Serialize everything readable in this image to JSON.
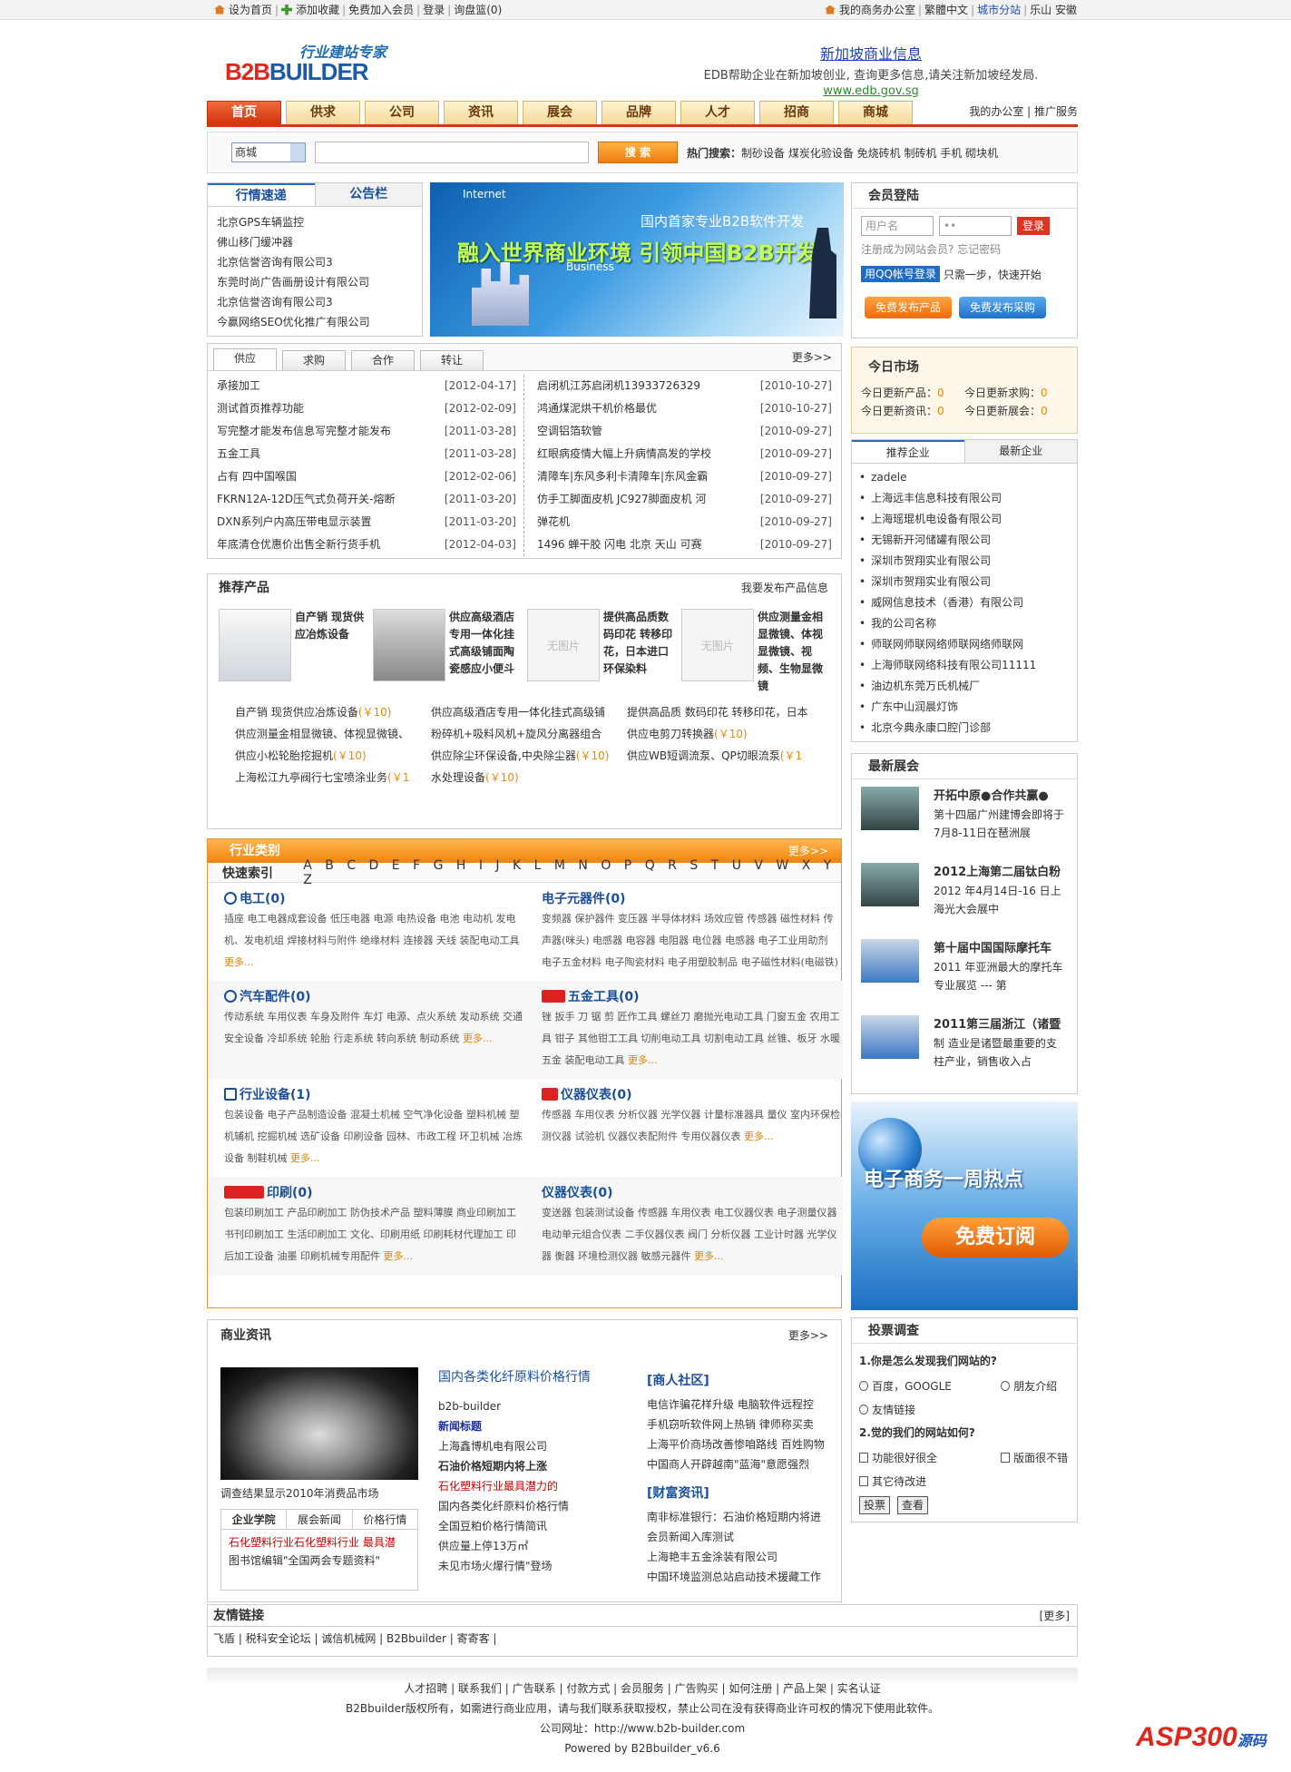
{
  "topbar": {
    "left": [
      "设为首页",
      "添加收藏",
      "免费加入会员",
      "登录",
      "询盘篮(0)"
    ],
    "right_office": "我的商务办公室",
    "right_lang": "繁體中文",
    "right_city": "城市分站",
    "right_region": "乐山 安徽"
  },
  "logo": {
    "slogan": "行业建站专家",
    "name_a": "B2B",
    "name_b": "BUILDER"
  },
  "ad": {
    "line1": "新加坡商业信息",
    "line2": "EDB帮助企业在新加坡创业, 查询更多信息,请关注新加坡经发局.",
    "line3": "www.edb.gov.sg"
  },
  "nav": {
    "tabs": [
      "首页",
      "供求",
      "公司",
      "资讯",
      "展会",
      "品牌",
      "人才",
      "招商",
      "商城"
    ],
    "right": "我的办公室 | 推广服务"
  },
  "search": {
    "select": "商城",
    "button": "搜 索",
    "hot_label": "热门搜索：",
    "hot": "制砂设备 煤炭化验设备 免烧砖机 制砖机 手机 砌块机"
  },
  "market": {
    "tabs": [
      "行情速递",
      "公告栏"
    ],
    "items": [
      "北京GPS车辆监控",
      "佛山移门缓冲器",
      "北京信誉咨询有限公司3",
      "东莞时尚广告画册设计有限公司",
      "北京信誉咨询有限公司3",
      "今赢网络SEO优化推广有限公司"
    ]
  },
  "banner": {
    "net": "Internet",
    "line1": "国内首家专业B2B软件开发",
    "line2": "融入世界商业环境  引领中国B2B开发",
    "business": "Business"
  },
  "supply": {
    "tabs": [
      "供应",
      "求购",
      "合作",
      "转让"
    ],
    "more": "更多>>",
    "left": [
      {
        "t": "承接加工",
        "d": "[2012-04-17]"
      },
      {
        "t": "测试首页推荐功能",
        "d": "[2012-02-09]"
      },
      {
        "t": "写完整才能发布信息写完整才能发布",
        "d": "[2011-03-28]"
      },
      {
        "t": "五金工具",
        "d": "[2011-03-28]"
      },
      {
        "t": "占有 四中国喉国",
        "d": "[2012-02-06]"
      },
      {
        "t": "FKRN12A-12D压气式负荷开关-熔断",
        "d": "[2011-03-20]"
      },
      {
        "t": "DXN系列户内高压带电显示装置",
        "d": "[2011-03-20]"
      },
      {
        "t": "年底清仓优惠价出售全新行货手机",
        "d": "[2012-04-03]"
      }
    ],
    "right": [
      {
        "t": "启闭机江苏启闭机13933726329",
        "d": "[2010-10-27]"
      },
      {
        "t": "鸿通煤泥烘干机价格最优",
        "d": "[2010-10-27]"
      },
      {
        "t": "空调铝箔软管",
        "d": "[2010-09-27]"
      },
      {
        "t": "红眼病疫情大幅上升病情高发的学校",
        "d": "[2010-09-27]"
      },
      {
        "t": "清障车|东风多利卡清障车|东风金霸",
        "d": "[2010-09-27]"
      },
      {
        "t": "仿手工脚面皮机 JC927脚面皮机 河",
        "d": "[2010-09-27]"
      },
      {
        "t": "弹花机",
        "d": "[2010-09-27]"
      },
      {
        "t": "1496 蝉干胶 闪电 北京 天山 可赛",
        "d": "[2010-09-27]"
      }
    ]
  },
  "products": {
    "title": "推荐产品",
    "more": "我要发布产品信息",
    "noimg": "无图片",
    "items": [
      "自产销 现货供应冶炼设备",
      "供应高级酒店专用一体化挂式高级铺面陶瓷感应小便斗",
      "提供高品质数码印花 转移印花，日本进口环保染料",
      "供应测量金相显微镜、体视显微镜、视频、生物显微镜"
    ],
    "list": [
      {
        "t": "自产销 现货供应冶炼设备",
        "p": "(￥10)"
      },
      {
        "t": "供应高级酒店专用一体化挂式高级铺",
        "p": ""
      },
      {
        "t": "提供高品质 数码印花 转移印花，日本",
        "p": ""
      },
      {
        "t": "供应测量金相显微镜、体视显微镜、",
        "p": ""
      },
      {
        "t": "粉碎机+吸料风机+旋风分离器组合",
        "p": ""
      },
      {
        "t": "供应电剪刀转换器",
        "p": "(￥10)"
      },
      {
        "t": "供应小松轮胎挖掘机",
        "p": "(￥10)"
      },
      {
        "t": "供应除尘环保设备,中央除尘器",
        "p": "(￥10)"
      },
      {
        "t": "供应WB短调流泵、QP切眼流泵",
        "p": "(￥1"
      },
      {
        "t": "上海松江九亭阀行七宝喷涂业务",
        "p": "(￥1"
      },
      {
        "t": "水处理设备",
        "p": "(￥10)"
      },
      {
        "t": "",
        "p": ""
      }
    ]
  },
  "category": {
    "title": "行业类别",
    "more": "更多>>",
    "index_label": "快速索引",
    "letters": "A B C D E F G H I J K L M N O P Q R S T U V W X Y Z",
    "more_link": "更多...",
    "cells": [
      {
        "t": "电工(0)",
        "b": "插座 电工电器成套设备 低压电器 电源 电热设备 电池 电动机 发电机、发电机组 焊接材料与附件 绝缘材料 连接器 天线 装配电动工具"
      },
      {
        "t": "电子元器件(0)",
        "b": "变频器 保护器件 变压器 半导体材料 场效应管 传感器 磁性材料 传声器(咪头) 电感器 电容器 电阻器 电位器 电感器 电子工业用助剂 电子五金材料 电子陶瓷材料 电子用塑胶制品 电子磁性材料(电磁铁) 敏感元器件"
      },
      {
        "t": "汽车配件(0)",
        "b": "传动系统 车用仪表 车身及附件 车灯 电源、点火系统 发动系统 交通安全设备 冷却系统 轮胎 行走系统 转向系统 制动系统"
      },
      {
        "t": "五金工具(0)",
        "b": "锉 扳手 刀 锯 剪 匠作工具 螺丝刀 磨抛光电动工具 门窗五金 农用工具 钳子 其他钳工工具 切削电动工具 切割电动工具 丝锥、板牙 水暖五金 装配电动工具"
      },
      {
        "t": "行业设备(1)",
        "b": "包装设备 电子产品制造设备 混凝土机械 空气净化设备 塑料机械 塑机辅机 挖掘机械 选矿设备 印刷设备 园林、市政工程 环卫机械 冶炼设备 制鞋机械"
      },
      {
        "t": "仪器仪表(0)",
        "b": "传感器 车用仪表 分析仪器 光学仪器 计量标准器具 量仪 室内环保检测仪器 试验机 仪器仪表配附件 专用仪器仪表"
      },
      {
        "t": "印刷(0)",
        "b": "包装印刷加工 产品印刷加工 防伪技术产品 塑料薄膜 商业印刷加工 书刊印刷加工 生活印刷加工 文化、印刷用纸 印刷耗材代理加工 印后加工设备 油墨 印刷机械专用配件"
      },
      {
        "t": "仪器仪表(0)",
        "b": "变送器 包装测试设备 传感器 车用仪表 电工仪器仪表 电子测量仪器 电动单元组合仪表 二手仪器仪表 阀门 分析仪器 工业计时器 光学仪器 衡器 环境检测仪器 敏感元器件"
      }
    ]
  },
  "biz": {
    "title": "商业资讯",
    "more": "更多>>",
    "caption": "调查结果显示2010年消费品市场",
    "tabs": [
      "企业学院",
      "展会新闻",
      "价格行情"
    ],
    "tab_items": [
      "石化塑料行业石化塑料行业 最具潜",
      "图书馆编辑\"全国两会专题资料\""
    ],
    "mid_head": "国内各类化纤原料价格行情",
    "mid": [
      "b2b-builder",
      "新闻标题",
      "上海鑫博机电有限公司",
      "石油价格短期内将上涨",
      "石化塑料行业最具潜力的",
      "国内各类化纤原料价格行情",
      "全国豆粕价格行情简讯",
      "供应量上停13万㎡",
      "未见市场火爆行情\"登场"
    ],
    "r_head1": "[商人社区]",
    "r1": [
      "电信诈骗花样升级 电脑软件远程控",
      "手机窃听软件网上热销 律师称买卖",
      "上海平价商场改善惨咱路线 百姓购物",
      "中国商人开辟越南\"蓝海\"意愿强烈"
    ],
    "r_head2": "[财富资讯]",
    "r2": [
      "南非标准银行：石油价格短期内将进",
      "会员新闻入库测试",
      "上海艳丰五金涂装有限公司",
      "中国环境监测总站启动技术援藏工作"
    ]
  },
  "links": {
    "title": "友情链接",
    "more": "[更多]",
    "items": "飞盾 | 税科安全论坛 | 诚信机械网 | B2Bbuilder | 寄寄客 |"
  },
  "footer": {
    "line1": "人才招聘 | 联系我们 | 广告联系 | 付款方式 | 会员服务 | 广告购买 | 如何注册 | 产品上架 | 实名认证",
    "line2": "B2Bbuilder版权所有，如需进行商业应用，请与我们联系获取授权，禁止公司在没有获得商业许可权的情况下使用此软件。",
    "line3": "公司网址：http://www.b2b-builder.com",
    "line4": "Powered by B2Bbuilder_v6.6"
  },
  "login": {
    "title": "会员登陆",
    "user_ph": "用户名",
    "pass_ph": "••",
    "btn": "登录",
    "links": "注册成为网站会员? 忘记密码",
    "qq_btn": "用QQ帐号登录",
    "qq_text": "只需一步，快速开始",
    "pub1": "免费发布产品",
    "pub2": "免费发布采购"
  },
  "today": {
    "title": "今日市场",
    "rows": [
      [
        "今日更新产品：",
        "0",
        "今日更新求购：",
        "0"
      ],
      [
        "今日更新资讯：",
        "0",
        "今日更新展会：",
        "0"
      ]
    ]
  },
  "enterprise": {
    "tabs": [
      "推荐企业",
      "最新企业"
    ],
    "items": [
      "zadele",
      "上海远丰信息科技有限公司",
      "上海瑶琨机电设备有限公司",
      "无锡新开河储罐有限公司",
      "深圳市贺翔实业有限公司",
      "深圳市贺翔实业有限公司",
      "威网信息技术（香港）有限公司",
      "我的公司名称",
      "师联网师联网络师联网络师联网",
      "上海师联网络科技有限公司11111",
      "油边机东莞万氏机械厂",
      "广东中山润晨灯饰",
      "北京今典永康口腔门诊部"
    ]
  },
  "expo": {
    "title": "最新展会",
    "items": [
      {
        "t": "开拓中原●合作共赢●",
        "d": "第十四届广州建博会即将于7月8-11日在琶洲展"
      },
      {
        "t": "2012上海第二届钛白粉",
        "d": "2012 年4月14日-16 日上海光大会展中"
      },
      {
        "t": "第十届中国国际摩托车",
        "d": "2011 年亚洲最大的摩托车专业展览 --- 第"
      },
      {
        "t": "2011第三届浙江（诸暨",
        "d": "制 造业是诸暨最重要的支柱产业，销售收入占"
      }
    ]
  },
  "promo": {
    "t": "电子商务一周热点",
    "sub": "免费订阅"
  },
  "vote": {
    "title": "投票调查",
    "q1": "1.你是怎么发现我们网站的?",
    "q1opts": [
      "百度，GOOGLE",
      "朋友介绍",
      "友情链接"
    ],
    "q2": "2.觉的我们的网站如何?",
    "q2opts": [
      "功能很好很全",
      "版面很不错",
      "其它待改进"
    ],
    "btn1": "投票",
    "btn2": "查看"
  },
  "watermark": {
    "a": "ASP300",
    "b": "源码"
  }
}
